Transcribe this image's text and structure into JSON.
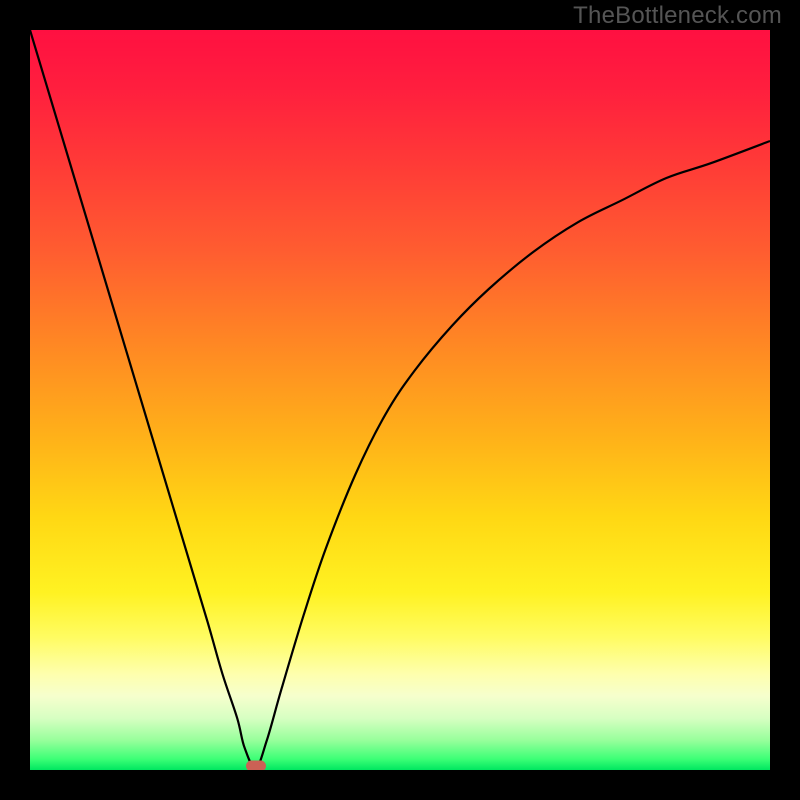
{
  "watermark": "TheBottleneck.com",
  "colors": {
    "frame": "#000000",
    "curve": "#000000",
    "marker": "#cb6155"
  },
  "chart_data": {
    "type": "line",
    "title": "",
    "xlabel": "",
    "ylabel": "",
    "xlim": [
      0,
      100
    ],
    "ylim": [
      0,
      100
    ],
    "grid": false,
    "legend": false,
    "minimum_x": 30.5,
    "series": [
      {
        "name": "curve",
        "x": [
          0,
          3,
          6,
          9,
          12,
          15,
          18,
          21,
          24,
          26,
          28,
          29,
          30.5,
          32,
          34,
          37,
          40,
          44,
          48,
          52,
          57,
          62,
          68,
          74,
          80,
          86,
          92,
          100
        ],
        "values": [
          100,
          90,
          80,
          70,
          60,
          50,
          40,
          30,
          20,
          13,
          7,
          3,
          0.3,
          4,
          11,
          21,
          30,
          40,
          48,
          54,
          60,
          65,
          70,
          74,
          77,
          80,
          82,
          85
        ]
      }
    ]
  }
}
